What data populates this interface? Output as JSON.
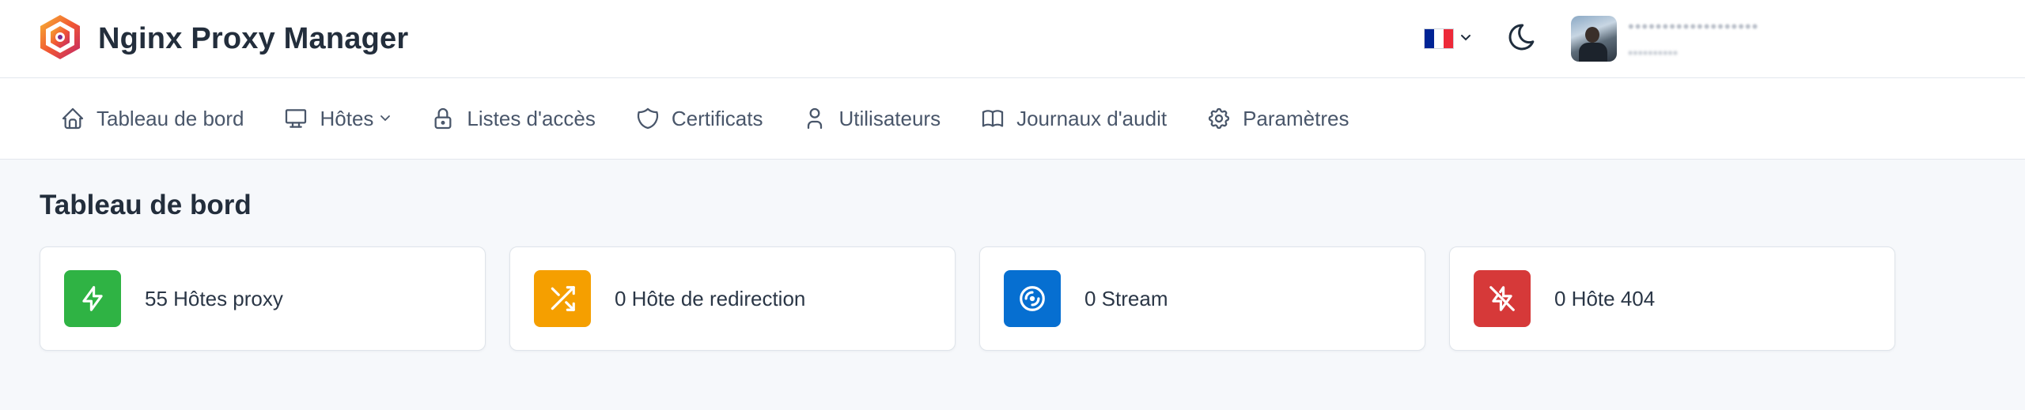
{
  "app": {
    "title": "Nginx Proxy Manager"
  },
  "topbar": {
    "language_icon": "french-flag-icon",
    "theme_icon": "moon-icon",
    "user": {
      "name": "•••••••••••••••••••",
      "role": "••••••••••"
    }
  },
  "nav": {
    "items": [
      {
        "label": "Tableau de bord",
        "icon": "home-icon"
      },
      {
        "label": "Hôtes",
        "icon": "monitor-icon"
      },
      {
        "label": "Listes d'accès",
        "icon": "lock-icon"
      },
      {
        "label": "Certificats",
        "icon": "shield-icon"
      },
      {
        "label": "Utilisateurs",
        "icon": "user-icon"
      },
      {
        "label": "Journaux d'audit",
        "icon": "book-icon"
      },
      {
        "label": "Paramètres",
        "icon": "gear-icon"
      }
    ]
  },
  "main": {
    "title": "Tableau de bord",
    "cards": [
      {
        "label": "55 Hôtes proxy",
        "icon": "bolt-icon",
        "color": "#2fb344"
      },
      {
        "label": "0 Hôte de redirection",
        "icon": "shuffle-icon",
        "color": "#f59f00"
      },
      {
        "label": "0 Stream",
        "icon": "disc-icon",
        "color": "#066fd1"
      },
      {
        "label": "0 Hôte 404",
        "icon": "bolt-off-icon",
        "color": "#d63939"
      }
    ]
  },
  "colors": {
    "flag_blue": "#002395",
    "flag_white": "#ffffff",
    "flag_red": "#ed2939",
    "logo": "#f15833"
  }
}
